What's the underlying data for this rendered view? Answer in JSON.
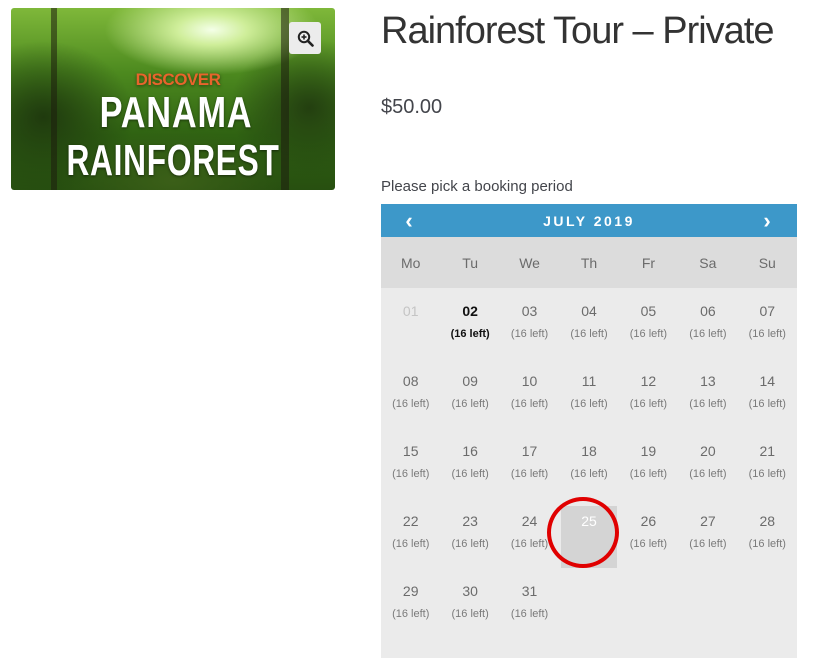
{
  "product": {
    "title": "Rainforest Tour – Private",
    "price": "$50.00",
    "image_text": {
      "discover": "DISCOVER",
      "line1": "PANAMA",
      "line2": "RAINFOREST"
    },
    "zoom_icon": "magnifier-plus-icon"
  },
  "booking": {
    "pick_label": "Please pick a booking period",
    "month_label": "JULY 2019",
    "prev_icon": "‹",
    "next_icon": "›",
    "weekdays": [
      "Mo",
      "Tu",
      "We",
      "Th",
      "Fr",
      "Sa",
      "Su"
    ],
    "days": [
      {
        "num": "01",
        "left": "",
        "state": "disabled"
      },
      {
        "num": "02",
        "left": "(16 left)",
        "state": "today"
      },
      {
        "num": "03",
        "left": "(16 left)",
        "state": "available"
      },
      {
        "num": "04",
        "left": "(16 left)",
        "state": "available"
      },
      {
        "num": "05",
        "left": "(16 left)",
        "state": "available"
      },
      {
        "num": "06",
        "left": "(16 left)",
        "state": "available"
      },
      {
        "num": "07",
        "left": "(16 left)",
        "state": "available"
      },
      {
        "num": "08",
        "left": "(16 left)",
        "state": "available"
      },
      {
        "num": "09",
        "left": "(16 left)",
        "state": "available"
      },
      {
        "num": "10",
        "left": "(16 left)",
        "state": "available"
      },
      {
        "num": "11",
        "left": "(16 left)",
        "state": "available"
      },
      {
        "num": "12",
        "left": "(16 left)",
        "state": "available"
      },
      {
        "num": "13",
        "left": "(16 left)",
        "state": "available"
      },
      {
        "num": "14",
        "left": "(16 left)",
        "state": "available"
      },
      {
        "num": "15",
        "left": "(16 left)",
        "state": "available"
      },
      {
        "num": "16",
        "left": "(16 left)",
        "state": "available"
      },
      {
        "num": "17",
        "left": "(16 left)",
        "state": "available"
      },
      {
        "num": "18",
        "left": "(16 left)",
        "state": "available"
      },
      {
        "num": "19",
        "left": "(16 left)",
        "state": "available"
      },
      {
        "num": "20",
        "left": "(16 left)",
        "state": "available"
      },
      {
        "num": "21",
        "left": "(16 left)",
        "state": "available"
      },
      {
        "num": "22",
        "left": "(16 left)",
        "state": "available"
      },
      {
        "num": "23",
        "left": "(16 left)",
        "state": "available"
      },
      {
        "num": "24",
        "left": "(16 left)",
        "state": "available"
      },
      {
        "num": "25",
        "left": "",
        "state": "selected"
      },
      {
        "num": "26",
        "left": "(16 left)",
        "state": "available"
      },
      {
        "num": "27",
        "left": "(16 left)",
        "state": "available"
      },
      {
        "num": "28",
        "left": "(16 left)",
        "state": "available"
      },
      {
        "num": "29",
        "left": "(16 left)",
        "state": "available"
      },
      {
        "num": "30",
        "left": "(16 left)",
        "state": "available"
      },
      {
        "num": "31",
        "left": "(16 left)",
        "state": "available"
      }
    ]
  },
  "colors": {
    "header_blue": "#3d98c9",
    "highlight_red": "#e00000",
    "discover_orange": "#e8642c"
  }
}
